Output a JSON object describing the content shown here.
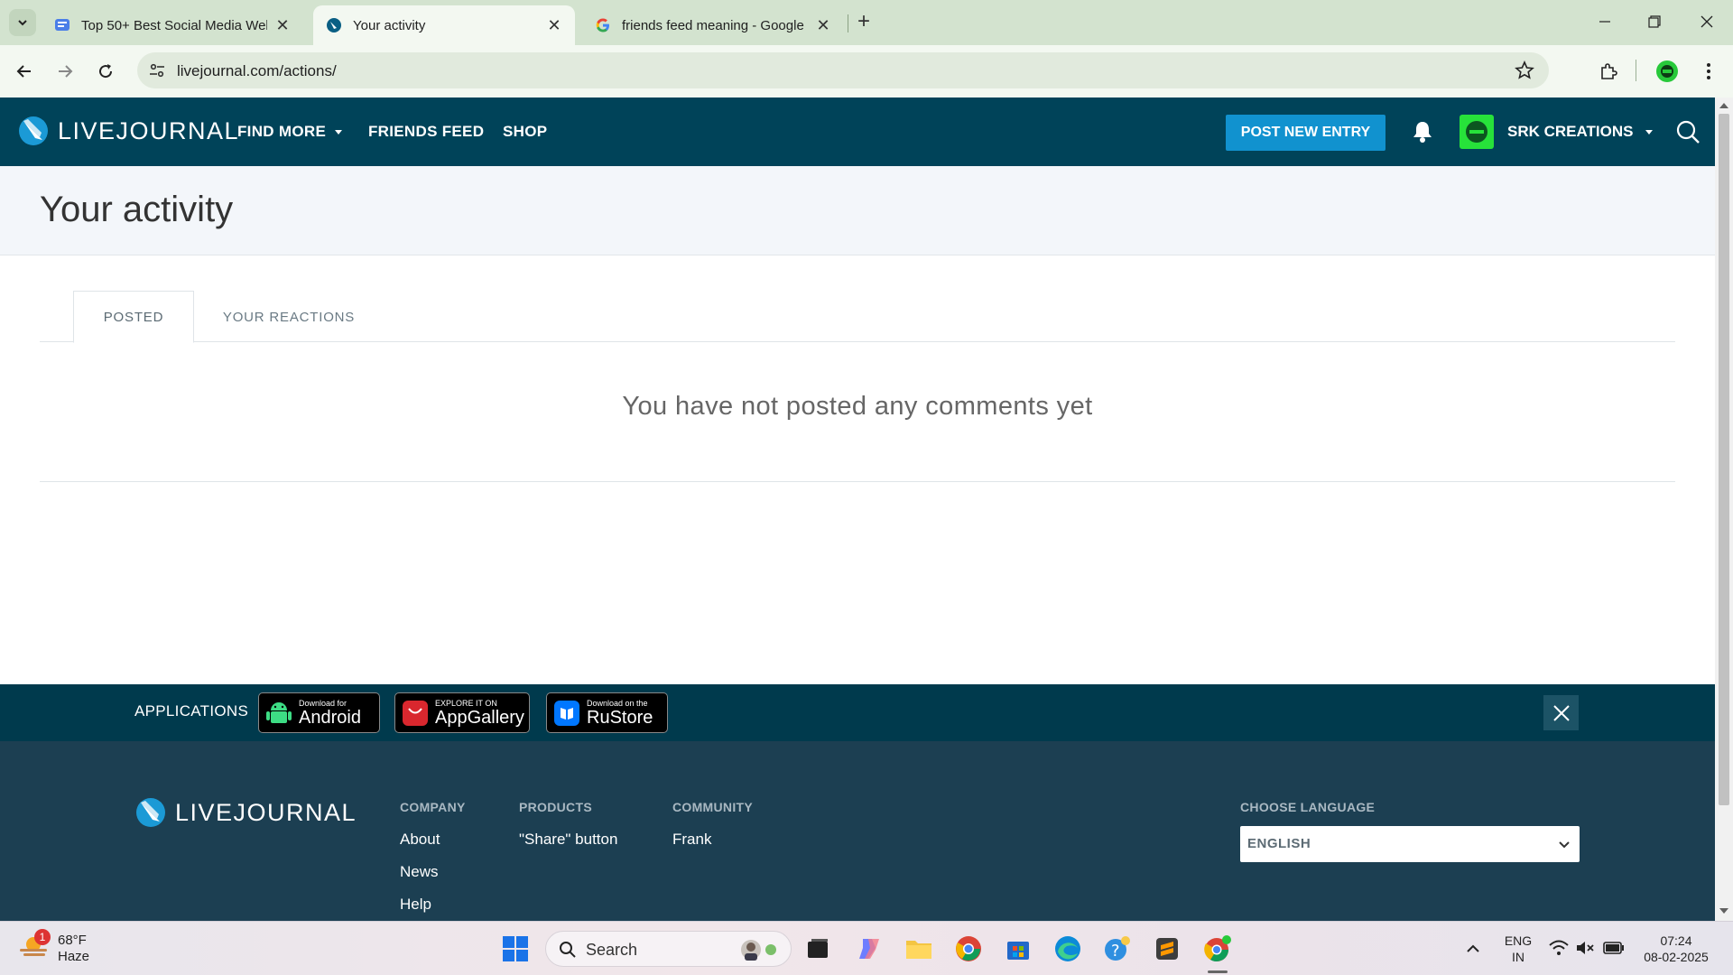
{
  "browser": {
    "tabs": [
      {
        "title": "Top 50+ Best Social Media Web"
      },
      {
        "title": "Your activity"
      },
      {
        "title": "friends feed meaning - Google"
      }
    ],
    "url": "livejournal.com/actions/"
  },
  "header": {
    "logo": "LIVEJOURNAL",
    "nav": {
      "find_more": "FIND MORE",
      "friends_feed": "FRIENDS FEED",
      "shop": "SHOP"
    },
    "post_button": "POST NEW ENTRY",
    "username": "SRK CREATIONS"
  },
  "page": {
    "title": "Your activity",
    "tabs": [
      {
        "label": "POSTED"
      },
      {
        "label": "YOUR REACTIONS"
      }
    ],
    "empty_message": "You have not posted any comments yet"
  },
  "apps_bar": {
    "label": "APPLICATIONS",
    "badges": [
      {
        "small": "Download for",
        "big": "Android"
      },
      {
        "small": "EXPLORE IT ON",
        "big": "AppGallery"
      },
      {
        "small": "Download on the",
        "big": "RuStore"
      }
    ]
  },
  "footer": {
    "logo": "LIVEJOURNAL",
    "company": {
      "heading": "COMPANY",
      "links": [
        "About",
        "News",
        "Help"
      ]
    },
    "products": {
      "heading": "PRODUCTS",
      "links": [
        "\"Share\" button"
      ]
    },
    "community": {
      "heading": "COMMUNITY",
      "links": [
        "Frank"
      ]
    },
    "language": {
      "heading": "CHOOSE LANGUAGE",
      "value": "ENGLISH"
    }
  },
  "taskbar": {
    "weather": {
      "temp": "68°F",
      "condition": "Haze",
      "badge": "1"
    },
    "search_label": "Search",
    "language": {
      "line1": "ENG",
      "line2": "IN"
    },
    "clock": {
      "time": "07:24",
      "date": "08-02-2025"
    }
  },
  "colors": {
    "header_bg": "#004359",
    "accent_button": "#1192cf",
    "footer_bg": "#1c3f52",
    "apps_bar_bg": "#003a4d",
    "avatar_green": "#27e23a"
  }
}
